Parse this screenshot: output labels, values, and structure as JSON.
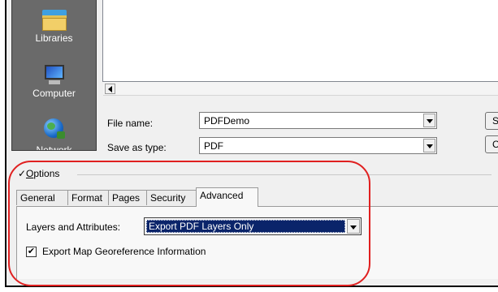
{
  "places": {
    "libraries": "Libraries",
    "computer": "Computer",
    "network": "Network"
  },
  "file_name": {
    "label": "File name:",
    "value": "PDFDemo"
  },
  "save_as_type": {
    "label": "Save as type:",
    "value": "PDF"
  },
  "side_buttons": {
    "save": "S",
    "cancel": "C"
  },
  "options": {
    "header_prefix": "✓",
    "header_underlined": "O",
    "header_rest": "ptions"
  },
  "tabs": [
    {
      "label": "General"
    },
    {
      "label": "Format"
    },
    {
      "label": "Pages"
    },
    {
      "label": "Security"
    },
    {
      "label": "Advanced"
    }
  ],
  "advanced": {
    "layers_label": "Layers and Attributes:",
    "layers_value": "Export PDF Layers Only",
    "georef_label": "Export Map Georeference Information",
    "georef_checked": "✔"
  },
  "colors": {
    "annotation": "#e02020",
    "selection": "#0a246a",
    "places_bg": "#6a6a6a"
  }
}
